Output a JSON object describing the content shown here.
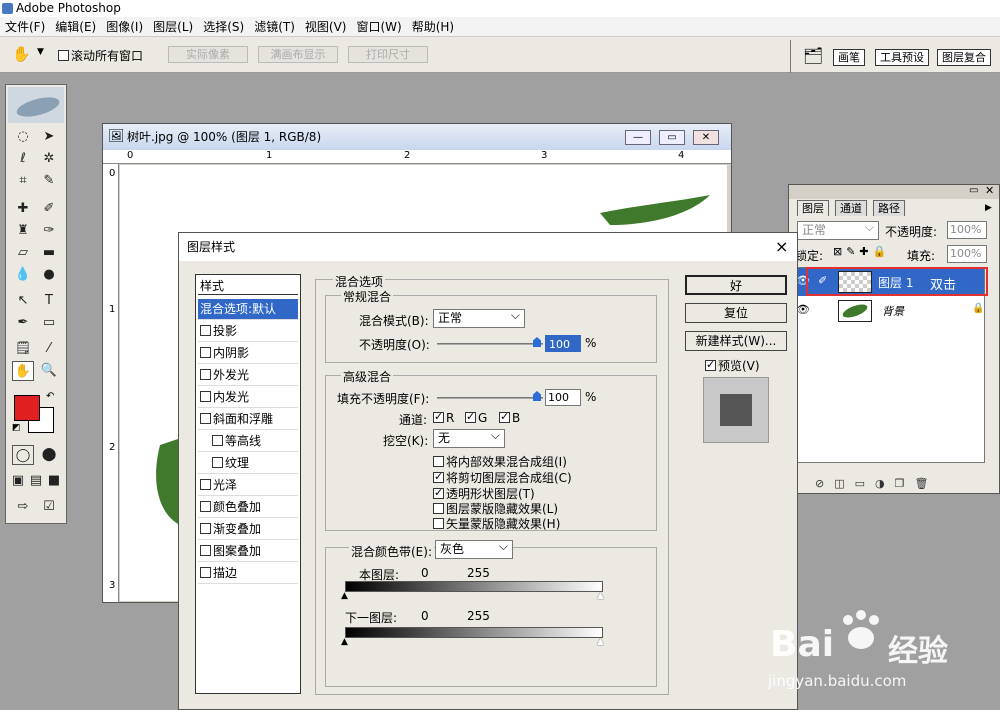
{
  "app": {
    "title": "Adobe Photoshop"
  },
  "menu": [
    "文件(F)",
    "编辑(E)",
    "图像(I)",
    "图层(L)",
    "选择(S)",
    "滤镜(T)",
    "视图(V)",
    "窗口(W)",
    "帮助(H)"
  ],
  "options": {
    "scroll_all": "滚动所有窗口",
    "actual_pixels": "实际像素",
    "fit_screen": "满画布显示",
    "print_size": "打印尺寸"
  },
  "palette_well": {
    "tabs": [
      "画笔",
      "工具预设",
      "图层复合"
    ]
  },
  "document": {
    "title": "树叶.jpg @ 100% (图层 1, RGB/8)",
    "ruler_h": [
      "0",
      "1",
      "2",
      "3",
      "4"
    ],
    "ruler_v": [
      "0",
      "1",
      "2",
      "3"
    ]
  },
  "layers": {
    "tabs": [
      "图层",
      "通道",
      "路径"
    ],
    "blend_mode": "正常",
    "opacity_label": "不透明度:",
    "opacity_value": "100%",
    "lock_label": "锁定:",
    "fill_label": "填充:",
    "fill_value": "100%",
    "rows": [
      {
        "name": "图层 1",
        "annotation": "双击"
      },
      {
        "name": "背景"
      }
    ]
  },
  "dialog": {
    "title": "图层样式",
    "close": "×",
    "styles_header": "样式",
    "styles": [
      "混合选项:默认",
      "投影",
      "内阴影",
      "外发光",
      "内发光",
      "斜面和浮雕",
      "等高线",
      "纹理",
      "光泽",
      "颜色叠加",
      "渐变叠加",
      "图案叠加",
      "描边"
    ],
    "blend_options": "混合选项",
    "general_blending": "常规混合",
    "blend_mode_label": "混合模式(B):",
    "blend_mode": "正常",
    "opacity_label": "不透明度(O):",
    "opacity": "100",
    "percent": "%",
    "advanced_blending": "高级混合",
    "fill_opacity_label": "填充不透明度(F):",
    "fill_opacity": "100",
    "channels_label": "通道:",
    "channels": [
      "R",
      "G",
      "B"
    ],
    "knockout_label": "挖空(K):",
    "knockout": "无",
    "checks": [
      {
        "label": "将内部效果混合成组(I)",
        "on": false
      },
      {
        "label": "将剪切图层混合成组(C)",
        "on": true
      },
      {
        "label": "透明形状图层(T)",
        "on": true
      },
      {
        "label": "图层蒙版隐藏效果(L)",
        "on": false
      },
      {
        "label": "矢量蒙版隐藏效果(H)",
        "on": false
      }
    ],
    "blend_if_label": "混合颜色带(E):",
    "blend_if": "灰色",
    "this_layer_label": "本图层:",
    "this_layer_min": "0",
    "this_layer_max": "255",
    "underlying_label": "下一图层:",
    "underlying_min": "0",
    "underlying_max": "255",
    "ok": "好",
    "reset": "复位",
    "new_style": "新建样式(W)...",
    "preview": "预览(V)"
  },
  "watermark": {
    "brand": "Bai",
    "brand_cn": "经验",
    "url": "jingyan.baidu.com"
  },
  "colors": {
    "foreground": "#e02020",
    "selection": "#3168c8",
    "annotation_border": "#e03030"
  }
}
